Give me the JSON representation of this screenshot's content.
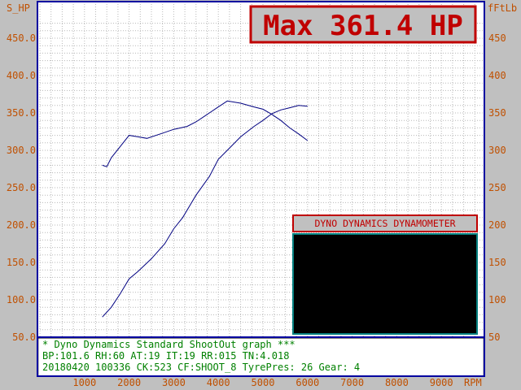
{
  "chart_data": {
    "type": "line",
    "y_left_label": "S_HP",
    "y_right_label": "fFtLb",
    "x_unit_label": "RPM",
    "xlim": [
      0,
      10000
    ],
    "ylim": [
      50,
      475
    ],
    "y_ticks": [
      "450.0",
      "400.0",
      "350.0",
      "300.0",
      "250.0",
      "200.0",
      "150.0",
      "100.0",
      "50.0"
    ],
    "y_right_ticks": [
      "450",
      "400",
      "350",
      "300",
      "250",
      "200",
      "150",
      "100",
      "50"
    ],
    "x_ticks": [
      "1000",
      "2000",
      "3000",
      "4000",
      "5000",
      "6000",
      "7000",
      "8000",
      "9000"
    ],
    "grid": true,
    "series": [
      {
        "name": "S_HP",
        "x": [
          1400,
          1600,
          1800,
          2000,
          2200,
          2500,
          2800,
          3000,
          3200,
          3500,
          3800,
          4000,
          4200,
          4500,
          4800,
          5000,
          5200,
          5400,
          5600,
          5800,
          6000
        ],
        "y": [
          77,
          90,
          108,
          128,
          138,
          155,
          175,
          195,
          210,
          240,
          265,
          288,
          300,
          318,
          332,
          340,
          349,
          354,
          357,
          360,
          359
        ]
      },
      {
        "name": "fFtLb",
        "x": [
          1400,
          1500,
          1600,
          1800,
          2000,
          2200,
          2400,
          2700,
          3000,
          3300,
          3500,
          3800,
          4000,
          4200,
          4500,
          4800,
          5000,
          5200,
          5400,
          5600,
          5800,
          6000
        ],
        "y": [
          280,
          278,
          290,
          305,
          320,
          318,
          316,
          322,
          328,
          332,
          338,
          350,
          358,
          366,
          363,
          358,
          355,
          348,
          340,
          330,
          322,
          313
        ]
      }
    ]
  },
  "max_box": {
    "text": "Max 361.4 HP"
  },
  "dyno_panel": {
    "title": "DYNO DYNAMICS DYNAMOMETER"
  },
  "info": {
    "line1": "* Dyno Dynamics Standard ShootOut graph ***",
    "line2": "BP:101.6 RH:60 AT:19 IT:19  RR:015 TN:4.018",
    "line3": "20180420 100336 CK:523 CF:SHOOT_8  TyrePres: 26       Gear: 4"
  },
  "colors": {
    "background": "#c0c0c0",
    "plot_bg": "#ffffff",
    "grid": "#b8b8b8",
    "curve": "#000080",
    "frame": "#0000a0",
    "axis_text": "#c05000",
    "max_text": "#c00000",
    "info_text": "#008000",
    "panel_border": "#008080"
  }
}
